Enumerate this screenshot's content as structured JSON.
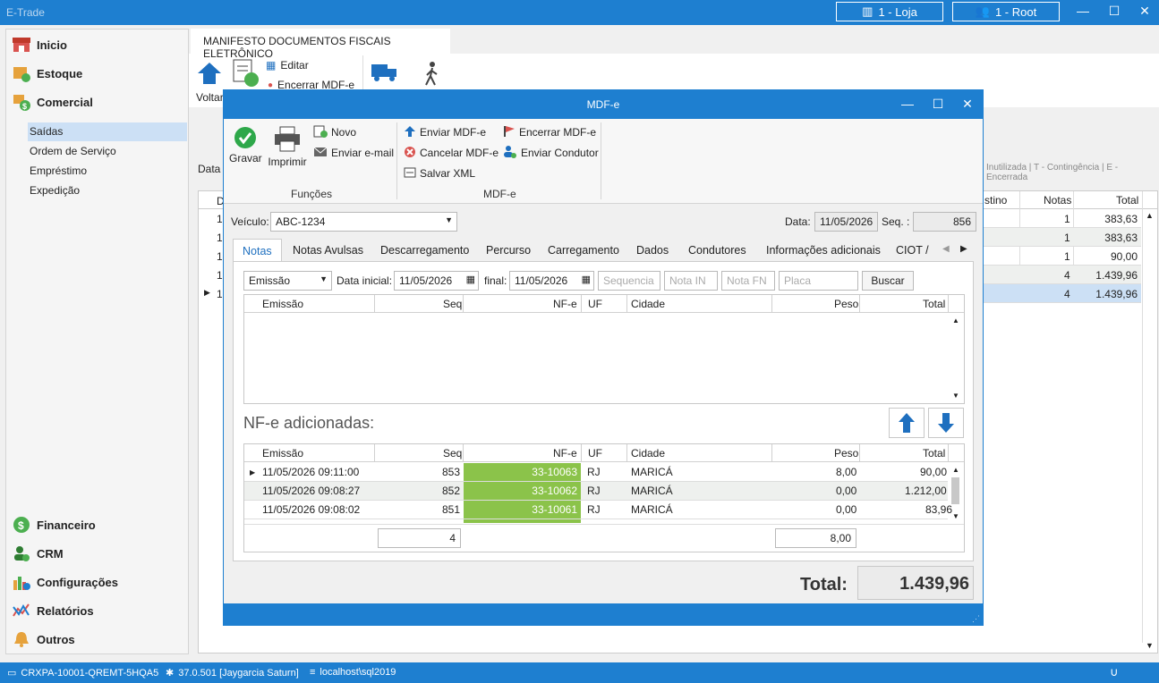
{
  "app": {
    "title": "E-Trade",
    "store_label": "1 - Loja",
    "user_label": "1 - Root"
  },
  "sidebar": {
    "main_items": [
      {
        "label": "Inicio"
      },
      {
        "label": "Estoque"
      },
      {
        "label": "Comercial"
      }
    ],
    "sub_items": [
      {
        "label": "Saídas"
      },
      {
        "label": "Ordem de Serviço"
      },
      {
        "label": "Empréstimo"
      },
      {
        "label": "Expedição"
      }
    ],
    "bottom_items": [
      {
        "label": "Financeiro"
      },
      {
        "label": "CRM"
      },
      {
        "label": "Configurações"
      },
      {
        "label": "Relatórios"
      },
      {
        "label": "Outros"
      }
    ]
  },
  "ribbon": {
    "tab_label": "MANIFESTO DOCUMENTOS FISCAIS ELETRÔNICO",
    "voltar": "Voltar",
    "editar": "Editar",
    "encerrar": "Encerrar MDF-e"
  },
  "background": {
    "data_label": "Data",
    "legend": "Inutilizada | T - Contingência | E - Encerrada",
    "col_destino": "stino",
    "col_notas": "Notas",
    "col_total": "Total",
    "row_prefix": [
      "D",
      "1",
      "1",
      "1",
      "1",
      "1"
    ],
    "rows": [
      {
        "notas": "1",
        "total": "383,63"
      },
      {
        "notas": "1",
        "total": "383,63"
      },
      {
        "notas": "1",
        "total": "90,00"
      },
      {
        "notas": "4",
        "total": "1.439,96"
      },
      {
        "notas": "4",
        "total": "1.439,96"
      }
    ]
  },
  "dialog": {
    "title": "MDF-e",
    "ribbon": {
      "gravar": "Gravar",
      "imprimir": "Imprimir",
      "novo": "Novo",
      "enviar_email": "Enviar e-mail",
      "enviar_mdfe": "Enviar MDF-e",
      "cancelar_mdfe": "Cancelar MDF-e",
      "salvar_xml": "Salvar XML",
      "encerrar_mdfe": "Encerrar MDF-e",
      "enviar_condutor": "Enviar Condutor",
      "group_funcoes": "Funções",
      "group_mdfe": "MDF-e"
    },
    "veiculo_label": "Veículo:",
    "veiculo_value": "ABC-1234",
    "data_label": "Data:",
    "data_value": "11/05/2026",
    "seq_label": "Seq. :",
    "seq_value": "856",
    "tabs": [
      "Notas",
      "Notas Avulsas",
      "Descarregamento",
      "Percurso",
      "Carregamento",
      "Dados",
      "Condutores",
      "Informações adicionais",
      "CIOT / V"
    ],
    "filter": {
      "tipo": "Emissão",
      "data_inicial_label": "Data inicial:",
      "data_inicial": "11/05/2026",
      "final_label": "final:",
      "final": "11/05/2026",
      "sequencia_ph": "Sequencia",
      "nota_in_ph": "Nota IN",
      "nota_fn_ph": "Nota FN",
      "placa_ph": "Placa",
      "buscar": "Buscar"
    },
    "columns": [
      "Emissão",
      "Seq",
      "NF-e",
      "UF",
      "Cidade",
      "Peso",
      "Total"
    ],
    "added_title": "NF-e adicionadas:",
    "added_rows": [
      {
        "emissao": "11/05/2026 09:11:00",
        "seq": "853",
        "nfe": "33-10063",
        "uf": "RJ",
        "cidade": "MARICÁ",
        "peso": "8,00",
        "total": "90,00"
      },
      {
        "emissao": "11/05/2026 09:08:27",
        "seq": "852",
        "nfe": "33-10062",
        "uf": "RJ",
        "cidade": "MARICÁ",
        "peso": "0,00",
        "total": "1.212,00"
      },
      {
        "emissao": "11/05/2026 09:08:02",
        "seq": "851",
        "nfe": "33-10061",
        "uf": "RJ",
        "cidade": "MARICÁ",
        "peso": "0,00",
        "total": "83,96"
      }
    ],
    "footer_count": "4",
    "footer_peso": "8,00",
    "total_label": "Total:",
    "total_value": "1.439,96"
  },
  "status": {
    "machine": "CRXPA-10001-QREMT-5HQA5",
    "version": "37.0.501 [Jaygarcia Saturn]",
    "server": "localhost\\sql2019"
  },
  "colors": {
    "accent": "#1e7fd0",
    "nfe_green": "#8bc34a",
    "selected_row": "#cce0f5"
  }
}
